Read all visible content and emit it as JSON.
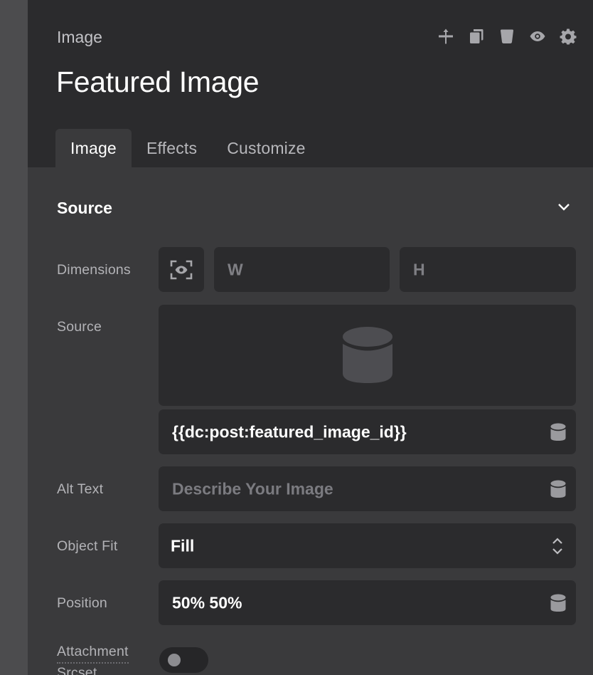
{
  "header": {
    "element_type": "Image",
    "element_name": "Featured Image",
    "actions": [
      {
        "icon": "move-icon"
      },
      {
        "icon": "duplicate-icon"
      },
      {
        "icon": "delete-icon"
      },
      {
        "icon": "visibility-icon"
      },
      {
        "icon": "settings-icon"
      }
    ]
  },
  "tabs": [
    {
      "label": "Image",
      "active": true
    },
    {
      "label": "Effects",
      "active": false
    },
    {
      "label": "Customize",
      "active": false
    }
  ],
  "section": {
    "title": "Source",
    "expanded": true
  },
  "fields": {
    "dimensions": {
      "label": "Dimensions",
      "width_placeholder": "W",
      "height_placeholder": "H"
    },
    "source": {
      "label": "Source",
      "value": "{{dc:post:featured_image_id}}"
    },
    "alt_text": {
      "label": "Alt Text",
      "placeholder": "Describe Your Image"
    },
    "object_fit": {
      "label": "Object Fit",
      "value": "Fill"
    },
    "position": {
      "label": "Position",
      "value": "50% 50%"
    },
    "attachment_srcset": {
      "label_line1": "Attachment",
      "label_line2": "Srcset",
      "enabled": false
    }
  },
  "colors": {
    "panel_bg": "#3a3a3c",
    "header_bg": "#2b2b2d",
    "field_bg": "#2b2b2d",
    "text_primary": "#ffffff",
    "text_label": "#b3b3b7"
  }
}
